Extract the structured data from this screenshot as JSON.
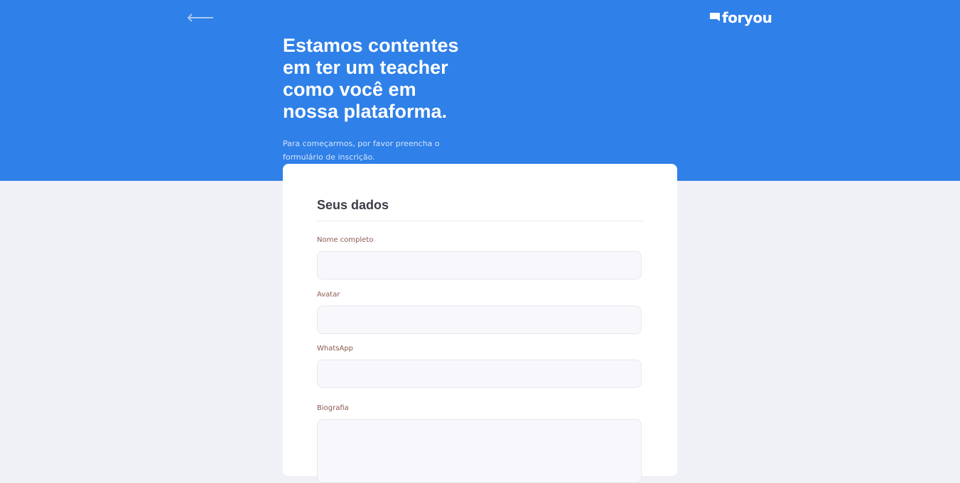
{
  "header": {
    "logo_text": "foryou",
    "headline": "Estamos contentes em ter um teacher como você em nossa plataforma.",
    "subtitle": "Para começarmos, por favor preencha o formulário de inscrição."
  },
  "form": {
    "title": "Seus dados",
    "fields": [
      {
        "label": "Nome completo",
        "value": ""
      },
      {
        "label": "Avatar",
        "value": ""
      },
      {
        "label": "WhatsApp",
        "value": ""
      },
      {
        "label": "Biografia",
        "value": ""
      }
    ]
  },
  "colors": {
    "brand_blue": "#2f80e8",
    "page_background": "#f0f0f7",
    "label_color": "#8a5a4e",
    "title_color": "#3e3b47"
  },
  "icons": {
    "back": "arrow-left-icon",
    "logo": "chat-bubble-icon"
  }
}
